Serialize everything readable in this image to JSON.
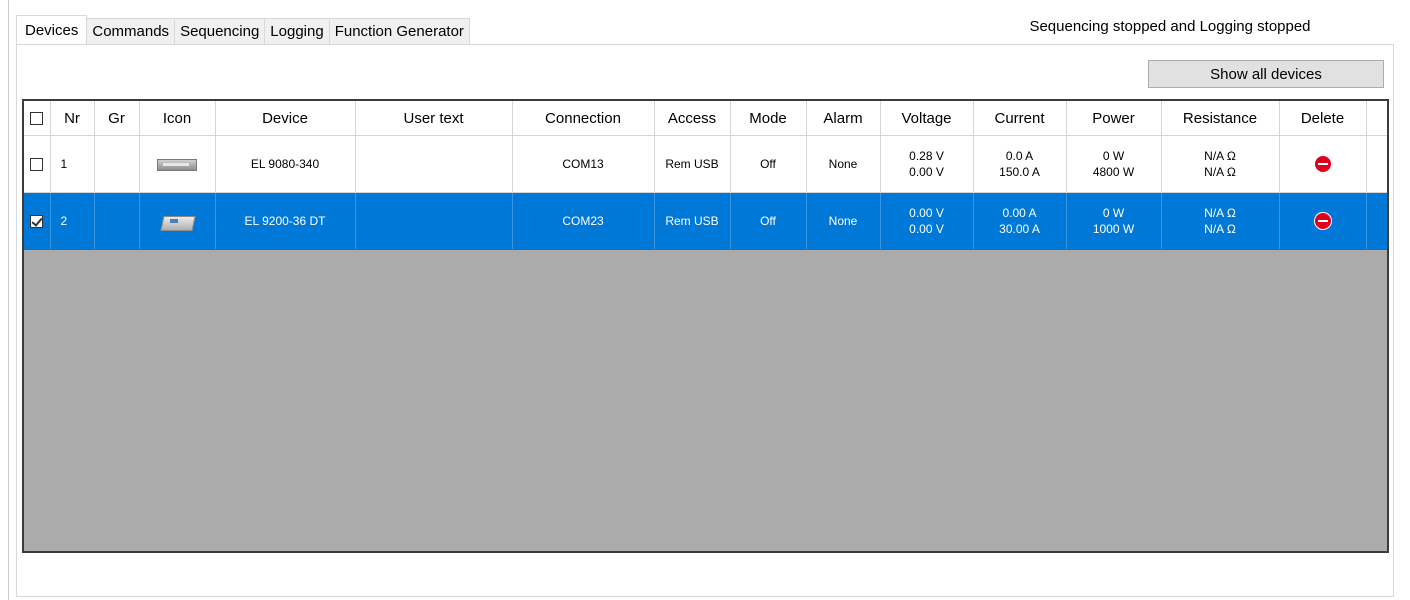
{
  "tabs": [
    "Devices",
    "Commands",
    "Sequencing",
    "Logging",
    "Function Generator"
  ],
  "status": "Sequencing stopped and Logging stopped",
  "show_all_label": "Show all devices",
  "columns": {
    "nr": "Nr",
    "gr": "Gr",
    "icon": "Icon",
    "device": "Device",
    "user_text": "User text",
    "connection": "Connection",
    "access": "Access",
    "mode": "Mode",
    "alarm": "Alarm",
    "voltage": "Voltage",
    "current": "Current",
    "power": "Power",
    "resistance": "Resistance",
    "delete": "Delete"
  },
  "rows": [
    {
      "nr": "1",
      "gr": "",
      "icon": "rack-device-icon",
      "device": "EL 9080-340",
      "user_text": "",
      "connection": "COM13",
      "access": "Rem USB",
      "mode": "Off",
      "alarm": "None",
      "voltage_actual": "0.28 V",
      "voltage_set": "0.00 V",
      "current_actual": "0.0 A",
      "current_set": "150.0 A",
      "power_actual": "0 W",
      "power_set": "4800 W",
      "resistance_actual": "N/A Ω",
      "resistance_set": "N/A Ω"
    },
    {
      "nr": "2",
      "gr": "",
      "icon": "desktop-device-icon",
      "device": "EL 9200-36 DT",
      "user_text": "",
      "connection": "COM23",
      "access": "Rem USB",
      "mode": "Off",
      "alarm": "None",
      "voltage_actual": "0.00 V",
      "voltage_set": "0.00 V",
      "current_actual": "0.00 A",
      "current_set": "30.00 A",
      "power_actual": "0 W",
      "power_set": "1000 W",
      "resistance_actual": "N/A Ω",
      "resistance_set": "N/A Ω"
    }
  ],
  "colors": {
    "selection": "#0078d7",
    "grid_background": "#ababab",
    "delete_icon": "#e0001b"
  }
}
